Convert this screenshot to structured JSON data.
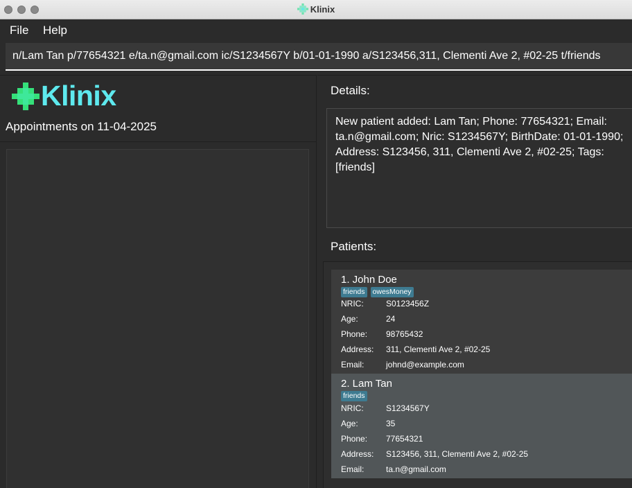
{
  "window": {
    "title": "Klinix"
  },
  "menu": {
    "file": "File",
    "help": "Help"
  },
  "command": {
    "value": "n/Lam Tan p/77654321 e/ta.n@gmail.com ic/S1234567Y b/01-01-1990 a/S123456,311, Clementi Ave 2, #02-25 t/friends"
  },
  "left": {
    "logo_text": "Klinix",
    "appointments_title": "Appointments on 11-04-2025"
  },
  "details": {
    "label": "Details:",
    "message": "New patient added: Lam Tan; Phone: 77654321; Email: ta.n@gmail.com; Nric: S1234567Y; BirthDate: 01-01-1990; Address: S123456, 311, Clementi Ave 2, #02-25; Tags: [friends]"
  },
  "patients": {
    "label": "Patients:",
    "field_labels": {
      "nric": "NRIC:",
      "age": "Age:",
      "phone": "Phone:",
      "address": "Address:",
      "email": "Email:"
    },
    "items": [
      {
        "name": "1. John Doe",
        "tags": [
          "friends",
          "owesMoney"
        ],
        "nric": "S0123456Z",
        "age": "24",
        "phone": "98765432",
        "address": "311, Clementi Ave 2, #02-25",
        "email": "johnd@example.com"
      },
      {
        "name": "2. Lam Tan",
        "tags": [
          "friends"
        ],
        "nric": "S1234567Y",
        "age": "35",
        "phone": "77654321",
        "address": "S123456, 311, Clementi Ave 2, #02-25",
        "email": "ta.n@gmail.com"
      }
    ]
  },
  "colors": {
    "accent_cyan": "#5ee9ee",
    "logo_green": "#35e07a",
    "tag_bg": "#3e7b91"
  },
  "icons": [
    "klinix-cross-icon"
  ]
}
